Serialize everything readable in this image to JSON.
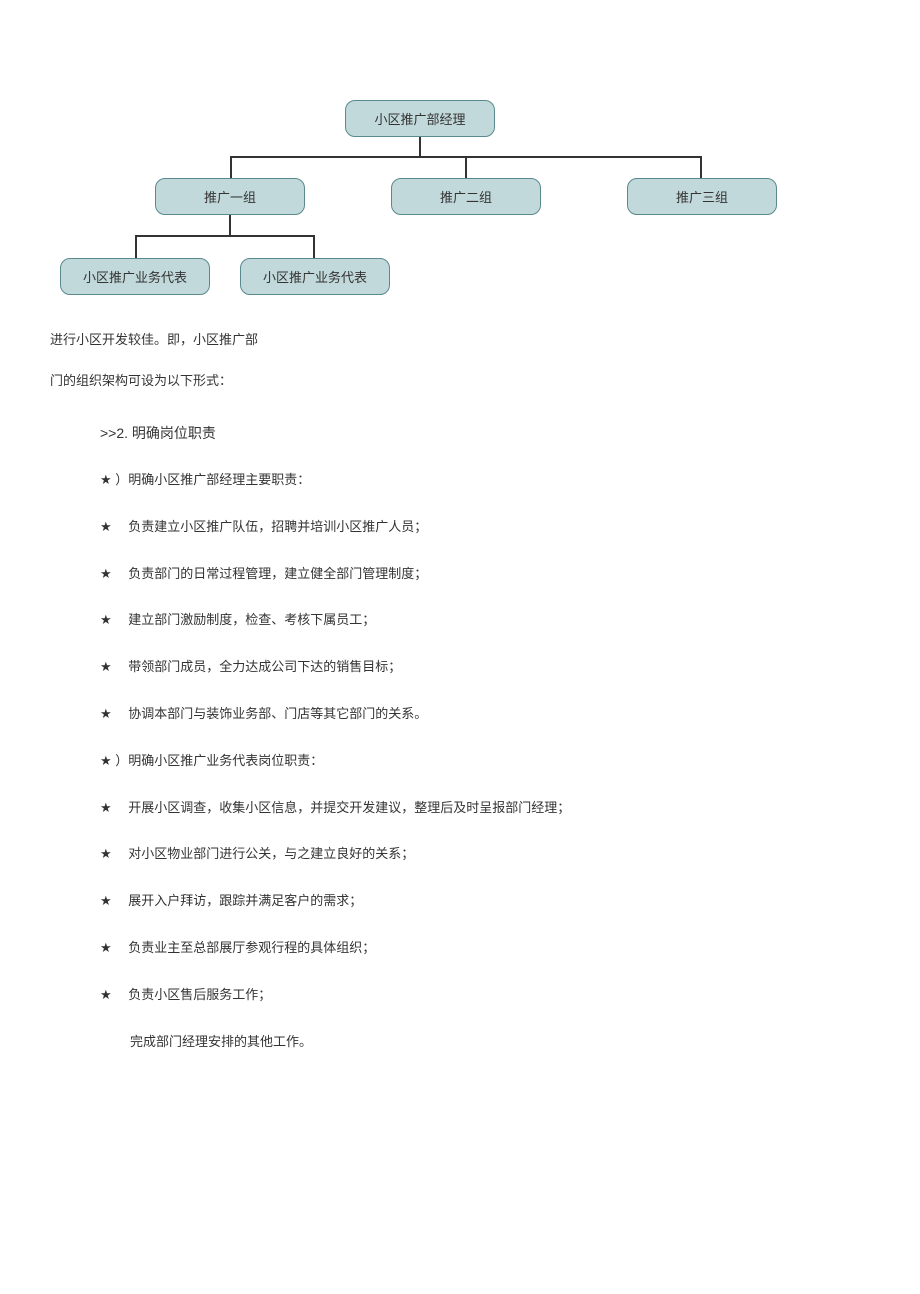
{
  "org": {
    "root": "小区推广部经理",
    "group1": "推广一组",
    "group2": "推广二组",
    "group3": "推广三组",
    "leaf1": "小区推广业务代表",
    "leaf2": "小区推广业务代表"
  },
  "text": {
    "para1": "进行小区开发较佳。即，小区推广部",
    "para2": "门的组织架构可设为以下形式：",
    "heading_marker": ">>2.",
    "heading_text": "明确岗位职责",
    "bullets": [
      "）明确小区推广部经理主要职责：",
      "　负责建立小区推广队伍，招聘并培训小区推广人员；",
      "　负责部门的日常过程管理，建立健全部门管理制度；",
      "　建立部门激励制度，检查、考核下属员工；",
      "　带领部门成员，全力达成公司下达的销售目标；",
      "　协调本部门与装饰业务部、门店等其它部门的关系。",
      "）明确小区推广业务代表岗位职责：",
      "　开展小区调查，收集小区信息，并提交开发建议，整理后及时呈报部门经理；",
      "　对小区物业部门进行公关，与之建立良好的关系；",
      "　展开入户拜访，跟踪并满足客户的需求；",
      "　负责业主至总部展厅参观行程的具体组织；",
      "　负责小区售后服务工作；"
    ],
    "final": "完成部门经理安排的其他工作。",
    "star": "★"
  }
}
